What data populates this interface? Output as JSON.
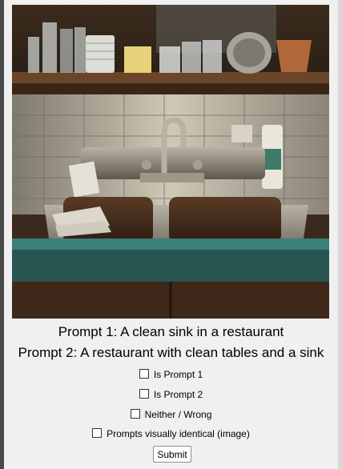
{
  "prompts": {
    "prompt1": "Prompt 1: A clean sink in a restaurant",
    "prompt2": "Prompt 2: A restaurant with clean tables and a sink"
  },
  "options": [
    {
      "label": "Is Prompt 1",
      "checked": false
    },
    {
      "label": "Is Prompt 2",
      "checked": false
    },
    {
      "label": "Neither / Wrong",
      "checked": false
    },
    {
      "label": "Prompts visually identical (image)",
      "checked": false
    }
  ],
  "submit_label": "Submit",
  "image_description_icon": "generated-image"
}
